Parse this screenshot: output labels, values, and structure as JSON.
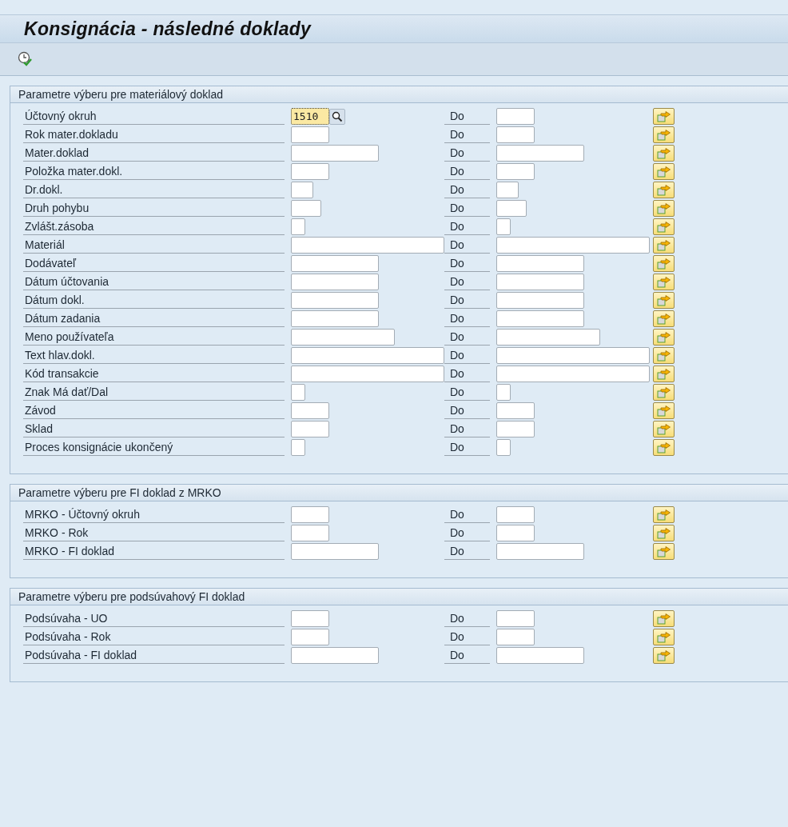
{
  "window": {
    "title": "Konsignácia -  následné doklady"
  },
  "toolbar": {
    "items": [
      {
        "kind": "execute"
      }
    ]
  },
  "sections": [
    {
      "title": "Parametre výberu pre materiálový doklad",
      "rows": [
        {
          "label": "Účtovný okruh",
          "low_value": "1510",
          "kind": "small",
          "focused": true,
          "value_help": true,
          "to_label": "Do"
        },
        {
          "label": "Rok mater.dokladu",
          "kind": "small",
          "focused": false,
          "value_help": false,
          "to_label": "Do"
        },
        {
          "label": "Mater.doklad",
          "kind": "large",
          "focused": false,
          "value_help": false,
          "to_label": "Do"
        },
        {
          "label": "Položka mater.dokl.",
          "kind": "small",
          "focused": false,
          "value_help": false,
          "to_label": "Do"
        },
        {
          "label": "Dr.dokl.",
          "kind": "xsmall",
          "focused": false,
          "value_help": false,
          "to_label": "Do"
        },
        {
          "label": "Druh pohybu",
          "kind": "compact",
          "focused": false,
          "value_help": false,
          "to_label": "Do"
        },
        {
          "label": "Zvlášt.zásoba",
          "kind": "tiny",
          "focused": false,
          "value_help": false,
          "to_label": "Do"
        },
        {
          "label": "Materiál",
          "kind": "xxlarge",
          "focused": false,
          "value_help": false,
          "to_label": "Do"
        },
        {
          "label": "Dodávateľ",
          "kind": "large",
          "focused": false,
          "value_help": false,
          "to_label": "Do"
        },
        {
          "label": "Dátum účtovania",
          "kind": "large",
          "focused": false,
          "value_help": false,
          "to_label": "Do"
        },
        {
          "label": "Dátum dokl.",
          "kind": "large",
          "focused": false,
          "value_help": false,
          "to_label": "Do"
        },
        {
          "label": "Dátum zadania",
          "kind": "large",
          "focused": false,
          "value_help": false,
          "to_label": "Do"
        },
        {
          "label": "Meno používateľa",
          "kind": "xlarge",
          "focused": false,
          "value_help": false,
          "to_label": "Do"
        },
        {
          "label": "Text hlav.dokl.",
          "kind": "xxlarge",
          "focused": false,
          "value_help": false,
          "to_label": "Do"
        },
        {
          "label": "Kód transakcie",
          "kind": "xxlarge",
          "focused": false,
          "value_help": false,
          "to_label": "Do"
        },
        {
          "label": "Znak Má dať/Dal",
          "kind": "tiny",
          "focused": false,
          "value_help": false,
          "to_label": "Do"
        },
        {
          "label": "Závod",
          "kind": "small",
          "focused": false,
          "value_help": false,
          "to_label": "Do"
        },
        {
          "label": "Sklad",
          "kind": "small",
          "focused": false,
          "value_help": false,
          "to_label": "Do"
        },
        {
          "label": "Proces konsignácie ukončený",
          "kind": "tiny",
          "focused": false,
          "value_help": false,
          "to_label": "Do"
        }
      ]
    },
    {
      "title": "Parametre výberu pre FI doklad z MRKO",
      "rows": [
        {
          "label": "MRKO - Účtovný okruh",
          "kind": "small",
          "focused": false,
          "value_help": false,
          "to_label": "Do"
        },
        {
          "label": "MRKO - Rok",
          "kind": "small",
          "focused": false,
          "value_help": false,
          "to_label": "Do"
        },
        {
          "label": "MRKO - FI doklad",
          "kind": "large",
          "focused": false,
          "value_help": false,
          "to_label": "Do"
        }
      ]
    },
    {
      "title": "Parametre výberu pre podsúvahový FI doklad",
      "rows": [
        {
          "label": "Podsúvaha -  UO",
          "kind": "small",
          "focused": false,
          "value_help": false,
          "to_label": "Do"
        },
        {
          "label": "Podsúvaha -  Rok",
          "kind": "small",
          "focused": false,
          "value_help": false,
          "to_label": "Do"
        },
        {
          "label": "Podsúvaha - FI doklad",
          "kind": "large",
          "focused": false,
          "value_help": false,
          "to_label": "Do"
        }
      ]
    }
  ]
}
